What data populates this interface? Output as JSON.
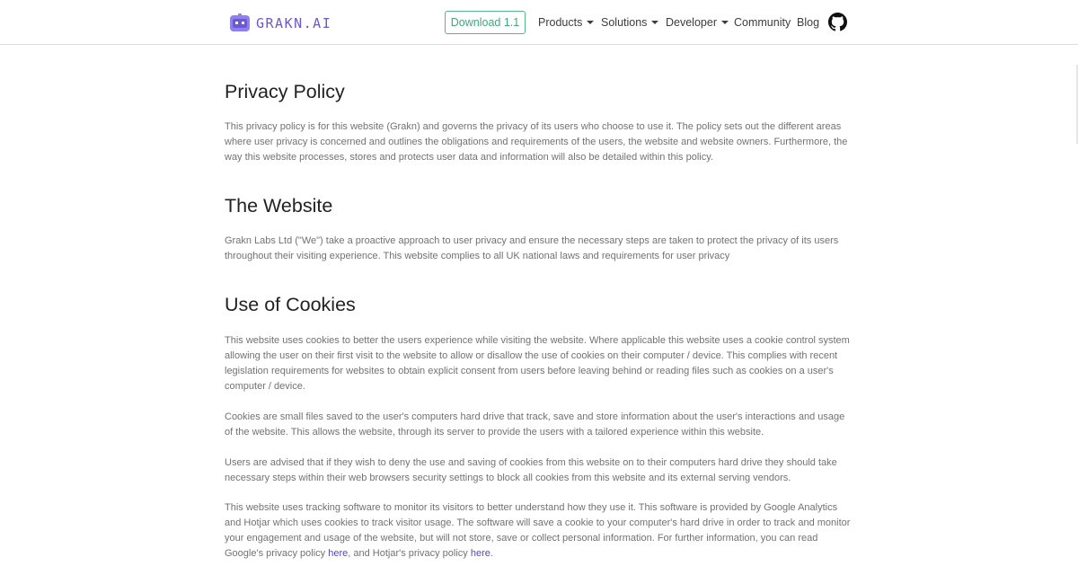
{
  "nav": {
    "logo_text": "GRAKN.AI",
    "download_label": "Download 1.1",
    "products_label": "Products",
    "solutions_label": "Solutions",
    "developer_label": "Developer",
    "community_label": "Community",
    "blog_label": "Blog"
  },
  "colors": {
    "brand_purple": "#6b59d3",
    "download_green": "#3fa97a",
    "link": "#5847c8"
  },
  "icons": {
    "logo": "grakn-robot-icon",
    "github": "github-icon",
    "dropdown": "caret-down-icon"
  },
  "privacy": {
    "title": "Privacy Policy",
    "intro": "This privacy policy is for this website (Grakn) and governs the privacy of its users who choose to use it. The policy sets out the different areas where user privacy is concerned and outlines the obligations and requirements of the users, the website and website owners. Furthermore, the way this website processes, stores and protects user data and information will also be detailed within this policy."
  },
  "website": {
    "heading": "The Website",
    "body": "Grakn Labs Ltd (\"We\") take a proactive approach to user privacy and ensure the necessary steps are taken to protect the privacy of its users throughout their visiting experience. This website complies to all UK national laws and requirements for user privacy"
  },
  "cookies": {
    "heading": "Use of Cookies",
    "p1": "This website uses cookies to better the users experience while visiting the website. Where applicable this website uses a cookie control system allowing the user on their first visit to the website to allow or disallow the use of cookies on their computer / device. This complies with recent legislation requirements for websites to obtain explicit consent from users before leaving behind or reading files such as cookies on a user's computer / device.",
    "p2": "Cookies are small files saved to the user's computers hard drive that track, save and store information about the user's interactions and usage of the website. This allows the website, through its server to provide the users with a tailored experience within this website.",
    "p3": "Users are advised that if they wish to deny the use and saving of cookies from this website on to their computers hard drive they should take necessary steps within their web browsers security settings to block all cookies from this website and its external serving vendors.",
    "p4_before_link1": "This website uses tracking software to monitor its visitors to better understand how they use it. This software is provided by Google Analytics and Hotjar which uses cookies to track visitor usage. The software will save a cookie to your computer's hard drive in order to track and monitor your engagement and usage of the website, but will not store, save or collect personal information. For further information, you can read Google's privacy policy ",
    "link1_label": "here",
    "p4_between": ", and Hotjar's privacy policy ",
    "link2_label": "here",
    "p4_end": "."
  }
}
